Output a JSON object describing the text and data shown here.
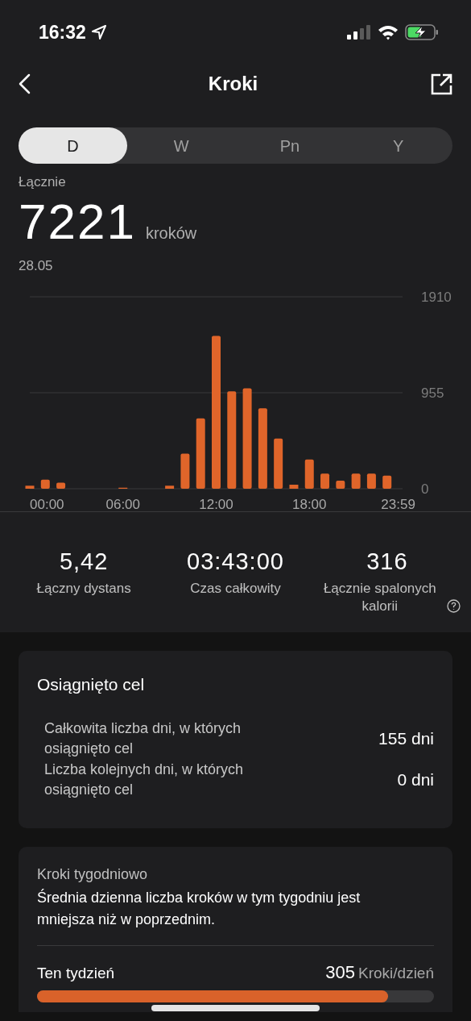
{
  "status_bar": {
    "time": "16:32"
  },
  "header": {
    "title": "Kroki"
  },
  "tabs": [
    {
      "label": "D",
      "selected": true
    },
    {
      "label": "W",
      "selected": false
    },
    {
      "label": "Pn",
      "selected": false
    },
    {
      "label": "Y",
      "selected": false
    }
  ],
  "summary": {
    "label": "Łącznie",
    "value": "7221",
    "unit": "kroków",
    "date": "28.05"
  },
  "chart_data": {
    "type": "bar",
    "x": [
      0,
      1,
      2,
      3,
      4,
      5,
      6,
      7,
      8,
      9,
      10,
      11,
      12,
      13,
      14,
      15,
      16,
      17,
      18,
      19,
      20,
      21,
      22,
      23
    ],
    "series": [
      {
        "color": "#e0652a",
        "values": [
          30,
          90,
          60,
          0,
          0,
          0,
          10,
          0,
          0,
          30,
          350,
          700,
          1520,
          970,
          1000,
          800,
          500,
          40,
          290,
          150,
          80,
          150,
          150,
          130
        ]
      }
    ],
    "xlim": [
      0,
      24
    ],
    "ylim": [
      0,
      1910
    ],
    "yticks": [
      0,
      955,
      1910
    ],
    "xticks": [
      {
        "value": 0,
        "label": "00:00"
      },
      {
        "value": 6,
        "label": "06:00"
      },
      {
        "value": 12,
        "label": "12:00"
      },
      {
        "value": 18,
        "label": "18:00"
      },
      {
        "value": 23.98,
        "label": "23:59"
      }
    ]
  },
  "stats": [
    {
      "value": "5,42",
      "label": "Łączny dystans"
    },
    {
      "value": "03:43:00",
      "label": "Czas całkowity"
    },
    {
      "value": "316",
      "label": "Łącznie spalonych kalorii",
      "info": true
    }
  ],
  "goal_card": {
    "title": "Osiągnięto cel",
    "rows": [
      {
        "label": "Całkowita liczba dni, w których osiągnięto cel",
        "value": "155 dni"
      },
      {
        "label": "Liczba kolejnych dni, w których osiągnięto cel",
        "value": "0 dni"
      }
    ]
  },
  "weekly_card": {
    "title": "Kroki tygodniowo",
    "message": "Średnia dzienna liczba kroków w tym tygodniu jest mniejsza niż w poprzednim.",
    "rows": [
      {
        "label": "Ten tydzień",
        "value": "305",
        "unit": "Kroki/dzień",
        "level": 0.885
      }
    ]
  }
}
